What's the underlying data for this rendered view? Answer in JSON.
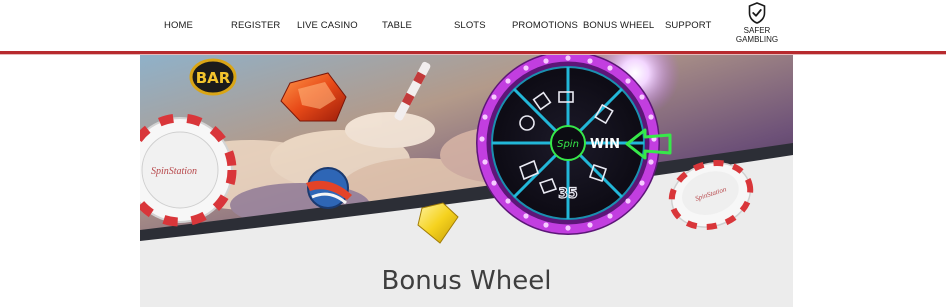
{
  "nav": {
    "items": [
      {
        "label": "HOME"
      },
      {
        "label": "REGISTER"
      },
      {
        "label": "LIVE CASINO"
      },
      {
        "label": "TABLE"
      },
      {
        "label": "SLOTS"
      },
      {
        "label": "PROMOTIONS"
      },
      {
        "label": "BONUS WHEEL"
      },
      {
        "label": "SUPPORT"
      }
    ],
    "safer_gambling": {
      "line1": "SAFER",
      "line2": "GAMBLING"
    }
  },
  "banner": {
    "bar_symbol": "BAR",
    "chip_brand": "SpinStation",
    "wheel_center": "Spin",
    "wheel_win": "WIN",
    "wheel_number": "35"
  },
  "page": {
    "title": "Bonus Wheel"
  },
  "colors": {
    "accent_red": "#b72a2e",
    "wheel_ring": "#c23ee0",
    "wheel_green": "#37e84a"
  }
}
